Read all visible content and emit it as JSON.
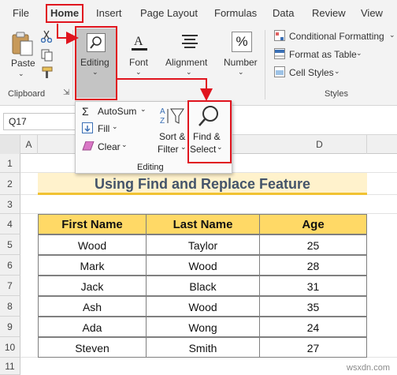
{
  "menu": {
    "file": "File",
    "home": "Home",
    "insert": "Insert",
    "page_layout": "Page Layout",
    "formulas": "Formulas",
    "data": "Data",
    "review": "Review",
    "view": "View"
  },
  "ribbon": {
    "paste": "Paste",
    "clipboard": "Clipboard",
    "editing": "Editing",
    "font": "Font",
    "alignment": "Alignment",
    "number": "Number",
    "number_symbol": "%",
    "conditional_formatting": "Conditional Formatting",
    "format_as_table": "Format as Table",
    "cell_styles": "Cell Styles",
    "styles": "Styles"
  },
  "namebox": "Q17",
  "editing_dropdown": {
    "autosum": "AutoSum",
    "fill": "Fill",
    "clear": "Clear",
    "sort_filter_line1": "Sort &",
    "sort_filter_line2": "Filter",
    "find_select_line1": "Find &",
    "find_select_line2": "Select",
    "group_label": "Editing"
  },
  "columns": [
    "A",
    "D"
  ],
  "rows": [
    "1",
    "2",
    "3",
    "4",
    "5",
    "6",
    "7",
    "8",
    "9",
    "10",
    "11"
  ],
  "sheet": {
    "title": "Using Find and Replace Feature",
    "headers": [
      "First Name",
      "Last Name",
      "Age"
    ],
    "data": [
      [
        "Wood",
        "Taylor",
        "25"
      ],
      [
        "Mark",
        "Wood",
        "28"
      ],
      [
        "Jack",
        "Black",
        "31"
      ],
      [
        "Ash",
        "Wood",
        "35"
      ],
      [
        "Ada",
        "Wong",
        "24"
      ],
      [
        "Steven",
        "Smith",
        "27"
      ]
    ]
  },
  "watermark": "wsxdn.com",
  "colors": {
    "highlight_red": "#e0141e",
    "header_fill": "#ffd966",
    "title_fill": "#fff2cc",
    "title_text": "#44546a"
  }
}
